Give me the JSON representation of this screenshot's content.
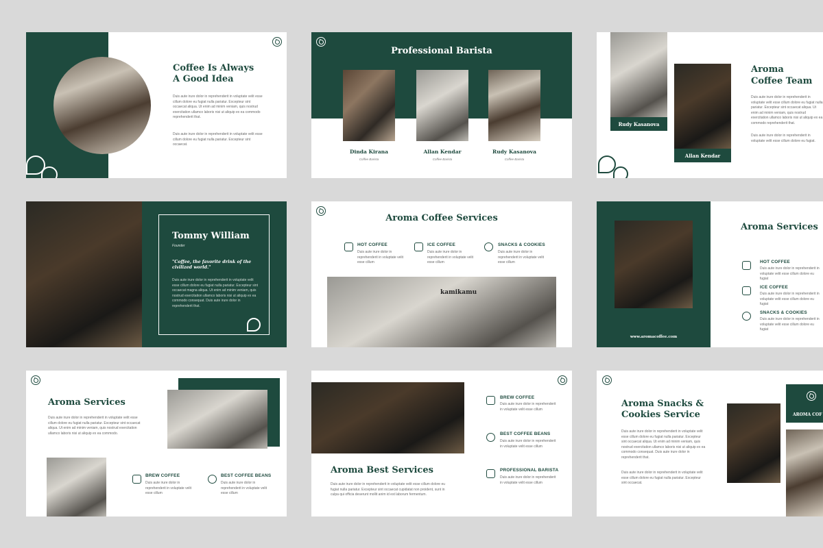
{
  "slide1": {
    "title_l1": "Coffee Is Always",
    "title_l2": "A Good Idea",
    "para1": "Duis aute irure dolor in reprehenderit in voluptate velit esse cillum dolore eu fugiat nulla pariatur. Excepteur sint occaecat aliqua. Ut enim ad minim veniam, quis nostrud exercitation ullamco laboris nisi ut aliquip ex ea commodo reprehenderit that.",
    "para2": "Duis aute irure dolor in reprehenderit in voluptate velit esse cillum dolore eu fugiat nulla pariatur. Excepteur sint occaecat."
  },
  "slide2": {
    "title": "Professional Barista",
    "people": [
      {
        "name": "Dinda Kirana",
        "role": "Coffee Barista"
      },
      {
        "name": "Allan Kendar",
        "role": "Coffee Barista"
      },
      {
        "name": "Rudy Kasanova",
        "role": "Coffee Barista"
      }
    ]
  },
  "slide3": {
    "title_l1": "Aroma",
    "title_l2": "Coffee Team",
    "name1": "Rudy Kasanova",
    "name2": "Allan Kendar",
    "para1": "Duis aute irure dolor in reprehenderit in voluptate velit esse cillum dolore eu fugiat nulla pariatur. Excepteur sint occaecat aliqua. Ut enim ad minim veniam, quis nostrud exercitation ullamco laboris nisi ut aliquip ex ea commodo reprehenderit that.",
    "para2": "Duis aute irure dolor in reprehenderit in voluptate velit esse cillum dolore eu fugiat."
  },
  "slide4": {
    "name": "Tommy William",
    "role": "Founder",
    "quote": "\"Coffee, the favorite drink of the civilized world.\"",
    "para": "Duis aute irure dolor in reprehenderit in voluptate velit esse cillum dolore eu fugiat nulla pariatur. Excepteur sint occaecat magna aliqua. Ut enim ad minim veniam, quis nostrud exercitation ullamco laboris nisi ut aliquip ex ea commodo consequat. Duis aute irure dolor in reprehenderit that."
  },
  "slide5": {
    "title": "Aroma Coffee Services",
    "sign": "kamikamu",
    "services": [
      {
        "label": "HOT COFFEE",
        "text": "Duis aute irure dolor in reprehenderit in voluptate velit esse cillum"
      },
      {
        "label": "ICE COFFEE",
        "text": "Duis aute irure dolor in reprehenderit in voluptate velit esse cillum"
      },
      {
        "label": "SNACKS & COOKIES",
        "text": "Duis aute irure dolor in reprehenderit in voluptate velit esse cillum"
      }
    ]
  },
  "slide6": {
    "title": "Aroma Services",
    "url": "www.aromacoffee.com",
    "services": [
      {
        "label": "HOT COFFEE",
        "text": "Duis aute irure dolor in reprehenderit in voluptate velit esse cillum dolore eu fugiat"
      },
      {
        "label": "ICE COFFEE",
        "text": "Duis aute irure dolor in reprehenderit in voluptate velit esse cillum dolore eu fugiat"
      },
      {
        "label": "SNACKS & COOKIES",
        "text": "Duis aute irure dolor in reprehenderit in voluptate velit esse cillum dolore eu fugiat"
      }
    ]
  },
  "slide7": {
    "title": "Aroma Services",
    "para": "Duis aute irure dolor in reprehenderit in voluptate velit esse cillum dolore eu fugiat nulla pariatur. Excepteur sint occaecat aliqua. Ut enim ad minim veniam, quis nostrud exercitation ullamco laboris nisi ut aliquip ex ea commodo.",
    "services": [
      {
        "label": "BREW COFFEE",
        "text": "Duis aute irure dolor in reprehenderit in voluptate velit esse cillum"
      },
      {
        "label": "BEST COFFEE BEANS",
        "text": "Duis aute irure dolor in reprehenderit in voluptate velit esse cillum"
      }
    ]
  },
  "slide8": {
    "title": "Aroma Best Services",
    "para": "Duis aute irure dolor in reprehenderit in voluptate velit esse cillum dolore eu fugiat nulla pariatur. Excepteur sint occaecat cupidatat non proident, sunt in culpa qui officia deserunt mollit anim id est laborum fermentum.",
    "services": [
      {
        "label": "BREW COFFEE",
        "text": "Duis aute irure dolor in reprehenderit in voluptate velit esse cillum"
      },
      {
        "label": "BEST COFFEE BEANS",
        "text": "Duis aute irure dolor in reprehenderit in voluptate velit esse cillum"
      },
      {
        "label": "PROFESSIONAL BARISTA",
        "text": "Duis aute irure dolor in reprehenderit in voluptate velit esse cillum"
      }
    ]
  },
  "slide9": {
    "title_l1": "Aroma Snacks &",
    "title_l2": "Cookies Service",
    "brand": "AROMA COF",
    "para1": "Duis aute irure dolor in reprehenderit in voluptate velit esse cillum dolore eu fugiat nulla pariatur. Excepteur sint occaecat aliqua. Ut enim ad minim veniam, quis nostrud exercitation ullamco laboris nisi ut aliquip ex ea commodo consequat. Duis aute irure dolor in reprehenderit that.",
    "para2": "Duis aute irure dolor in reprehenderit in voluptate velit esse cillum dolore eu fugiat nulla pariatur. Excepteur sint occaecat."
  },
  "colors": {
    "brand_green": "#1e4a3e",
    "background": "#d9d9d9"
  }
}
